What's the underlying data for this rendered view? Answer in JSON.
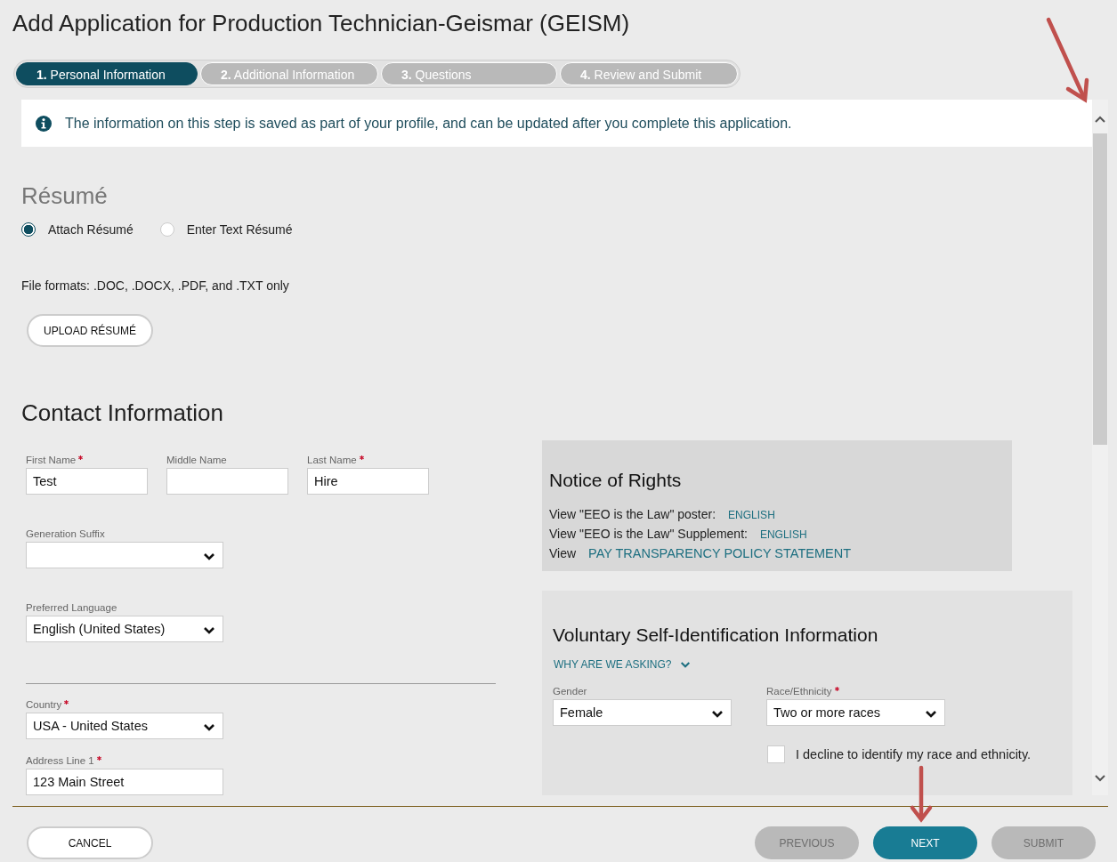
{
  "title": "Add Application for Production Technician-Geismar (GEISM)",
  "steps": [
    {
      "number": "1.",
      "label": "Personal Information",
      "selected": true
    },
    {
      "number": "2.",
      "label": "Additional Information",
      "selected": false
    },
    {
      "number": "3.",
      "label": "Questions",
      "selected": false
    },
    {
      "number": "4.",
      "label": "Review and Submit",
      "selected": false
    }
  ],
  "info_banner": "The information on this step is saved as part of your profile, and can be updated after you complete this application.",
  "resume": {
    "heading": "Résumé",
    "options": [
      {
        "label": "Attach Résumé",
        "selected": true
      },
      {
        "label": "Enter Text Résumé",
        "selected": false
      }
    ],
    "formats": "File formats: .DOC, .DOCX, .PDF, and .TXT only",
    "upload_button": "UPLOAD RÉSUMÉ"
  },
  "contact": {
    "heading": "Contact Information",
    "name_fields": [
      {
        "label": "First Name",
        "required": true,
        "value": "Test"
      },
      {
        "label": "Middle Name",
        "required": false
      },
      {
        "label": "Last Name",
        "required": true,
        "value": "Hire"
      }
    ],
    "personal_fields": [
      {
        "label": "Generation Suffix",
        "required": false
      },
      {
        "label": "Preferred Language",
        "required": false,
        "value": "English (United States)"
      }
    ],
    "address_fields": [
      {
        "kind": "select",
        "label": "Country",
        "required": true,
        "value": "USA - United States"
      },
      {
        "kind": "text",
        "label": "Address Line 1",
        "required": true,
        "value": "123 Main Street"
      }
    ]
  },
  "notice": {
    "heading": "Notice of Rights",
    "lines": [
      {
        "text": "View \"EEO is the Law\" poster:",
        "link": "ENGLISH",
        "kind": "small"
      },
      {
        "text": "View \"EEO is the Law\" Supplement:",
        "link": "ENGLISH",
        "kind": "small"
      },
      {
        "text": "View",
        "link": "PAY TRANSPARENCY POLICY STATEMENT",
        "kind": "large"
      }
    ]
  },
  "self_id": {
    "heading": "Voluntary Self-Identification Information",
    "why_link": "WHY ARE WE ASKING?",
    "fields": [
      {
        "label": "Gender",
        "required": false,
        "value": "Female"
      },
      {
        "label": "Race/Ethnicity",
        "required": true,
        "value": "Two or more races"
      }
    ],
    "decline": {
      "label": "I decline to identify my race and ethnicity.",
      "checked": false
    }
  },
  "footer": {
    "cancel": "CANCEL",
    "buttons": [
      {
        "label": "PREVIOUS",
        "disabled": true
      },
      {
        "label": "NEXT",
        "disabled": false
      },
      {
        "label": "SUBMIT",
        "disabled": true
      }
    ]
  }
}
